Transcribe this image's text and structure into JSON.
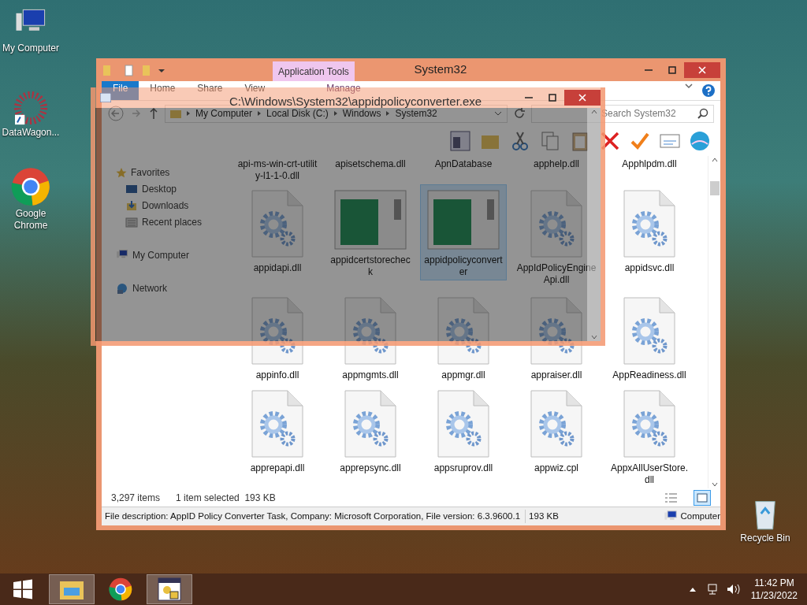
{
  "desktop_icons": [
    {
      "label": "My Computer",
      "kind": "computer"
    },
    {
      "label": "DataWagon...",
      "kind": "datawagon"
    },
    {
      "label": "Google Chrome",
      "kind": "chrome"
    },
    {
      "label": "Recycle Bin",
      "kind": "bin"
    }
  ],
  "explorer": {
    "title": "System32",
    "context_tab": "Application Tools",
    "ribbon_tabs": [
      {
        "label": "File",
        "kind": "file"
      },
      {
        "label": "Home",
        "kind": "tab"
      },
      {
        "label": "Share",
        "kind": "tab"
      },
      {
        "label": "View",
        "kind": "tab"
      },
      {
        "label": "Manage",
        "kind": "context"
      }
    ],
    "breadcrumbs": [
      "My Computer",
      "Local Disk (C:)",
      "Windows",
      "System32"
    ],
    "search": {
      "placeholder": "Search System32"
    },
    "nav": [
      {
        "label": "Favorites",
        "kind": "star",
        "children": [
          {
            "label": "Desktop",
            "kind": "desktop"
          },
          {
            "label": "Downloads",
            "kind": "downloads"
          },
          {
            "label": "Recent places",
            "kind": "recent"
          }
        ]
      },
      {
        "label": "My Computer",
        "kind": "computer"
      },
      {
        "label": "Network",
        "kind": "network"
      }
    ],
    "files": [
      {
        "name": "api-ms-win-crt-utility-l1-1-0.dll",
        "kind": "none",
        "selected": false
      },
      {
        "name": "apisetschema.dll",
        "kind": "none",
        "selected": false
      },
      {
        "name": "ApnDatabase",
        "kind": "none",
        "selected": false
      },
      {
        "name": "apphelp.dll",
        "kind": "none",
        "selected": false
      },
      {
        "name": "Apphlpdm.dll",
        "kind": "none",
        "selected": false
      },
      {
        "name": "appidapi.dll",
        "kind": "gear",
        "selected": false
      },
      {
        "name": "appidcertstorecheck",
        "kind": "window",
        "selected": false
      },
      {
        "name": "appidpolicyconverter",
        "kind": "window",
        "selected": true
      },
      {
        "name": "AppIdPolicyEngineApi.dll",
        "kind": "gear",
        "selected": false
      },
      {
        "name": "appidsvc.dll",
        "kind": "gear",
        "selected": false
      },
      {
        "name": "appinfo.dll",
        "kind": "gear",
        "selected": false
      },
      {
        "name": "appmgmts.dll",
        "kind": "gear",
        "selected": false
      },
      {
        "name": "appmgr.dll",
        "kind": "gear",
        "selected": false
      },
      {
        "name": "appraiser.dll",
        "kind": "gear",
        "selected": false
      },
      {
        "name": "AppReadiness.dll",
        "kind": "gear",
        "selected": false
      },
      {
        "name": "apprepapi.dll",
        "kind": "gear",
        "selected": false
      },
      {
        "name": "apprepsync.dll",
        "kind": "gear",
        "selected": false
      },
      {
        "name": "appsruprov.dll",
        "kind": "gear",
        "selected": false
      },
      {
        "name": "appwiz.cpl",
        "kind": "gear",
        "selected": false
      },
      {
        "name": "AppxAllUserStore.dll",
        "kind": "gear",
        "selected": false
      }
    ],
    "status": {
      "items": "3,297 items",
      "selection": "1 item selected  193 KB"
    },
    "details_bar": {
      "description": "File description: AppID Policy Converter Task, Company: Microsoft Corporation, File version: 6.3.9600.1",
      "size": "193 KB",
      "zone": "Computer"
    }
  },
  "overlay_window": {
    "title": "C:\\Windows\\System32\\appidpolicyconverter.exe"
  },
  "taskbar": {
    "apps": [
      {
        "kind": "explorer",
        "running": true
      },
      {
        "kind": "chrome",
        "running": false
      },
      {
        "kind": "lock",
        "running": true
      }
    ],
    "time": "11:42 PM",
    "date": "11/23/2022"
  }
}
